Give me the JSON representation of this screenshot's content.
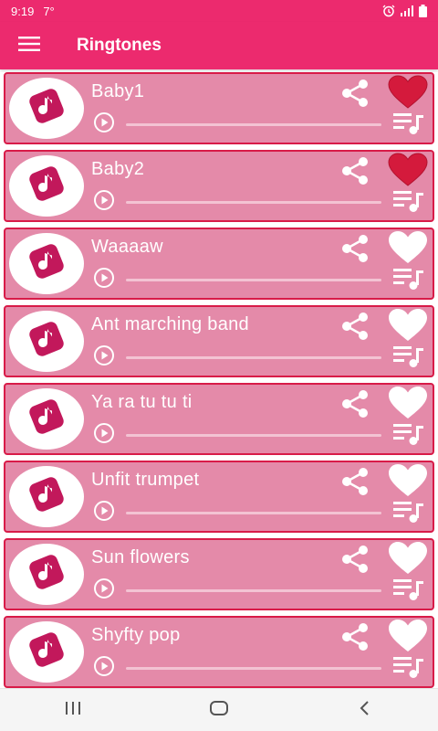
{
  "status_bar": {
    "time": "9:19",
    "extra": "7°"
  },
  "app_bar": {
    "title": "Ringtones"
  },
  "colors": {
    "accent": "#ec2a6e",
    "card_bg": "#e48aa9",
    "card_border": "#d81b48",
    "fav_active": "#d41a3c"
  },
  "ringtones": [
    {
      "title": "Baby1",
      "favorite": true
    },
    {
      "title": "Baby2",
      "favorite": true
    },
    {
      "title": "Waaaaw",
      "favorite": false
    },
    {
      "title": "Ant marching band",
      "favorite": false
    },
    {
      "title": "Ya ra tu tu ti",
      "favorite": false
    },
    {
      "title": "Unfit trumpet",
      "favorite": false
    },
    {
      "title": "Sun flowers",
      "favorite": false
    },
    {
      "title": "Shyfty pop",
      "favorite": false
    }
  ],
  "icons": {
    "menu": "menu-icon",
    "avatar": "music-note-icon",
    "play": "play-icon",
    "share": "share-icon",
    "favorite": "heart-icon",
    "playlist": "playlist-icon",
    "nav_recents": "recents-icon",
    "nav_home": "home-icon",
    "nav_back": "back-icon"
  }
}
